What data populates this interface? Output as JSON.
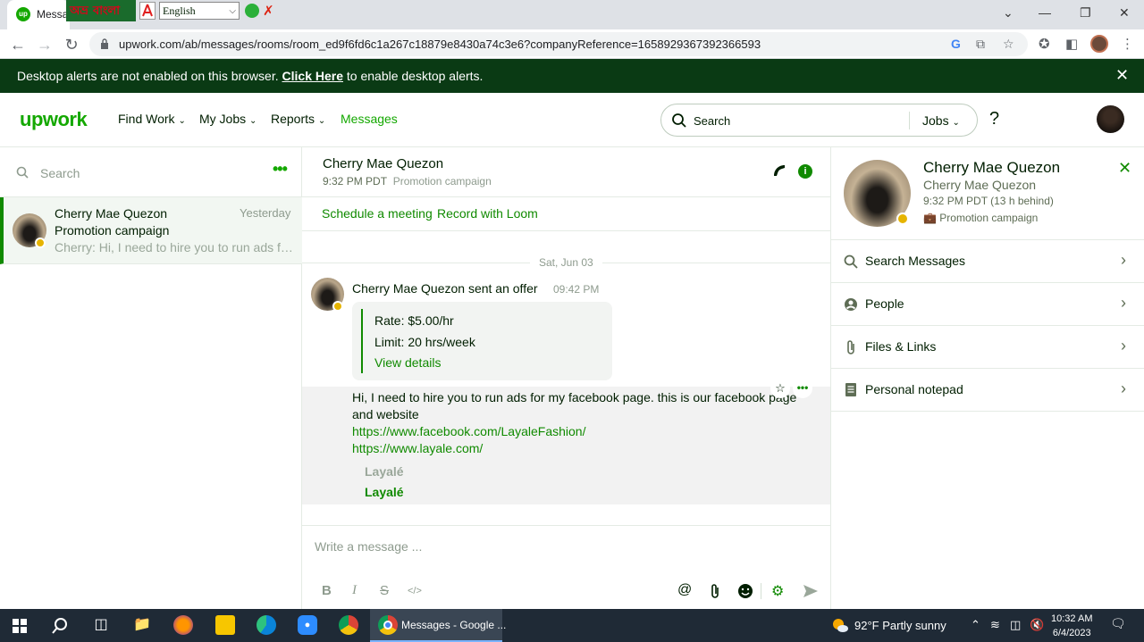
{
  "browser": {
    "tab_title": "Messa",
    "ext_bangla_logo": "অভ্র",
    "ext_bangla_text": "বাংলা",
    "language_select": "English",
    "url": "upwork.com/ab/messages/rooms/room_ed9f6fd6c1a267c18879e8430a74c3e6?companyReference=1658929367392366593"
  },
  "alert": {
    "text_before": "Desktop alerts are not enabled on this browser. ",
    "link": "Click Here",
    "text_after": " to enable desktop alerts."
  },
  "header": {
    "logo": "upwork",
    "nav": [
      {
        "label": "Find Work"
      },
      {
        "label": "My Jobs"
      },
      {
        "label": "Reports"
      },
      {
        "label": "Messages"
      }
    ],
    "search_placeholder": "Search",
    "search_scope": "Jobs"
  },
  "left_panel": {
    "search_placeholder": "Search",
    "room": {
      "name": "Cherry Mae Quezon",
      "when": "Yesterday",
      "subject": "Promotion campaign",
      "preview": "Cherry: Hi, I need to hire you to run ads for my facebook page. this is our facebook page and website"
    }
  },
  "conversation": {
    "name": "Cherry Mae Quezon",
    "local_time": "9:32 PM PDT",
    "context": "Promotion campaign",
    "actions": [
      "Schedule a meeting",
      "Record with Loom"
    ],
    "date_divider": "Sat, Jun 03",
    "offer_message": {
      "sender": "Cherry Mae Quezon",
      "verb": "sent an offer",
      "time": "09:42 PM",
      "rate": "Rate: $5.00/hr",
      "limit": "Limit: 20 hrs/week",
      "view": "View details"
    },
    "text_message": {
      "body": "Hi, I need to hire you to run ads for my facebook page. this is our facebook page and website",
      "url1": "https://www.facebook.com/LayaleFashion/",
      "url2": "https://www.layale.com/",
      "preview_title": "Layalé",
      "preview_link": "Layalé"
    },
    "composer_placeholder": "Write a message ..."
  },
  "right_panel": {
    "name": "Cherry Mae Quezon",
    "sub": "Cherry Mae Quezon",
    "time": "9:32 PM PDT (13 h behind)",
    "context": "Promotion campaign",
    "items": [
      {
        "label": "Search Messages",
        "icon": "search-icon"
      },
      {
        "label": "People",
        "icon": "person-icon"
      },
      {
        "label": "Files & Links",
        "icon": "paperclip-icon"
      },
      {
        "label": "Personal notepad",
        "icon": "notepad-icon"
      }
    ]
  },
  "taskbar": {
    "active_window": "Messages - Google ...",
    "weather": "92°F  Partly sunny",
    "time": "10:32 AM",
    "date": "6/4/2023"
  },
  "colors": {
    "brand_green": "#14a800",
    "link_green": "#108a00",
    "alert_bg": "#0a3a14",
    "status_yellow": "#e6b400"
  }
}
